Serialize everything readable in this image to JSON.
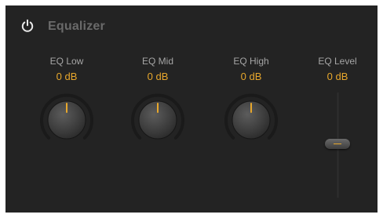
{
  "header": {
    "title": "Equalizer",
    "power_icon": "power-icon"
  },
  "controls": [
    {
      "label": "EQ Low",
      "value": "0 dB",
      "type": "knob"
    },
    {
      "label": "EQ Mid",
      "value": "0 dB",
      "type": "knob"
    },
    {
      "label": "EQ High",
      "value": "0 dB",
      "type": "knob"
    },
    {
      "label": "EQ Level",
      "value": "0 dB",
      "type": "fader"
    }
  ],
  "colors": {
    "panel": "#232323",
    "accent": "#e7a72c",
    "label": "#a5a5a5",
    "title": "#6a6a6a"
  }
}
